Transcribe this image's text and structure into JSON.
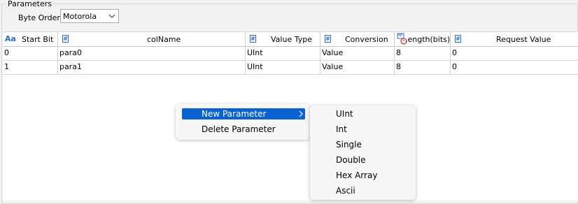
{
  "group": {
    "title": "Parameters"
  },
  "byte_order": {
    "label": "Byte Order",
    "value": "Motorola"
  },
  "table": {
    "columns": [
      {
        "icon": "text-type-icon",
        "label": "Start Bit"
      },
      {
        "icon": "number-type-icon",
        "label": "colName"
      },
      {
        "icon": "number-type-icon",
        "label": "Value Type"
      },
      {
        "icon": "number-type-icon",
        "label": "Conversion"
      },
      {
        "icon": "ruler-clock-icon",
        "label": ".ength(bits)"
      },
      {
        "icon": "number-type-icon",
        "label": "Request Value"
      }
    ],
    "aa_glyph": "Aa",
    "hash_glyph": "#",
    "rows": [
      [
        "0",
        "para0",
        "UInt",
        "Value",
        "8",
        "0"
      ],
      [
        "1",
        "para1",
        "UInt",
        "Value",
        "8",
        "0"
      ]
    ]
  },
  "context_menu": {
    "items": [
      "New Parameter",
      "Delete Parameter"
    ],
    "highlighted": "New Parameter"
  },
  "submenu": {
    "items": [
      "UInt",
      "Int",
      "Single",
      "Double",
      "Hex Array",
      "Ascii"
    ]
  },
  "colors": {
    "highlight": "#0a62d1",
    "icon_blue": "#2b6cc4"
  }
}
